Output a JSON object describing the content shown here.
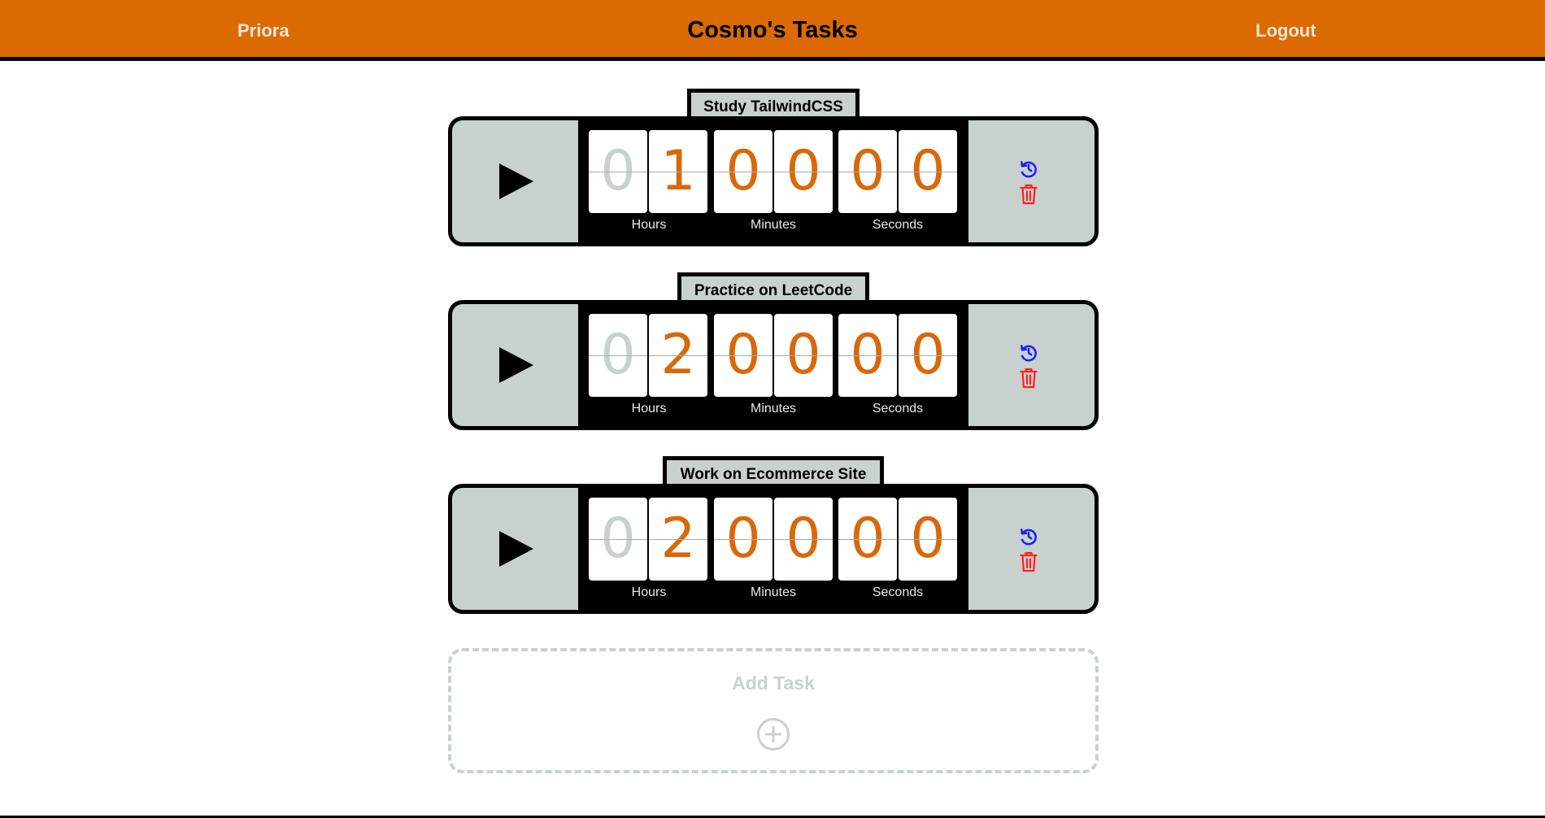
{
  "nav": {
    "brand": "Priora",
    "title": "Cosmo's Tasks",
    "logout": "Logout"
  },
  "colors": {
    "header": "#db6a00",
    "panel": "#c9d1cf",
    "digit": "#d9680a",
    "reset_icon": "#1a1aff",
    "delete_icon": "#ff2020"
  },
  "icons": {
    "play": "play-icon",
    "reset": "history-icon",
    "delete": "trash-icon",
    "add": "plus-circle-icon"
  },
  "tasks": [
    {
      "name": "Study TailwindCSS",
      "digits": [
        "0",
        "1",
        "0",
        "0",
        "0",
        "0"
      ],
      "labels": {
        "hours": "Hours",
        "minutes": "Minutes",
        "seconds": "Seconds"
      }
    },
    {
      "name": "Practice on LeetCode",
      "digits": [
        "0",
        "2",
        "0",
        "0",
        "0",
        "0"
      ],
      "labels": {
        "hours": "Hours",
        "minutes": "Minutes",
        "seconds": "Seconds"
      }
    },
    {
      "name": "Work on Ecommerce Site",
      "digits": [
        "0",
        "2",
        "0",
        "0",
        "0",
        "0"
      ],
      "labels": {
        "hours": "Hours",
        "minutes": "Minutes",
        "seconds": "Seconds"
      }
    }
  ],
  "add_task": {
    "label": "Add Task"
  }
}
